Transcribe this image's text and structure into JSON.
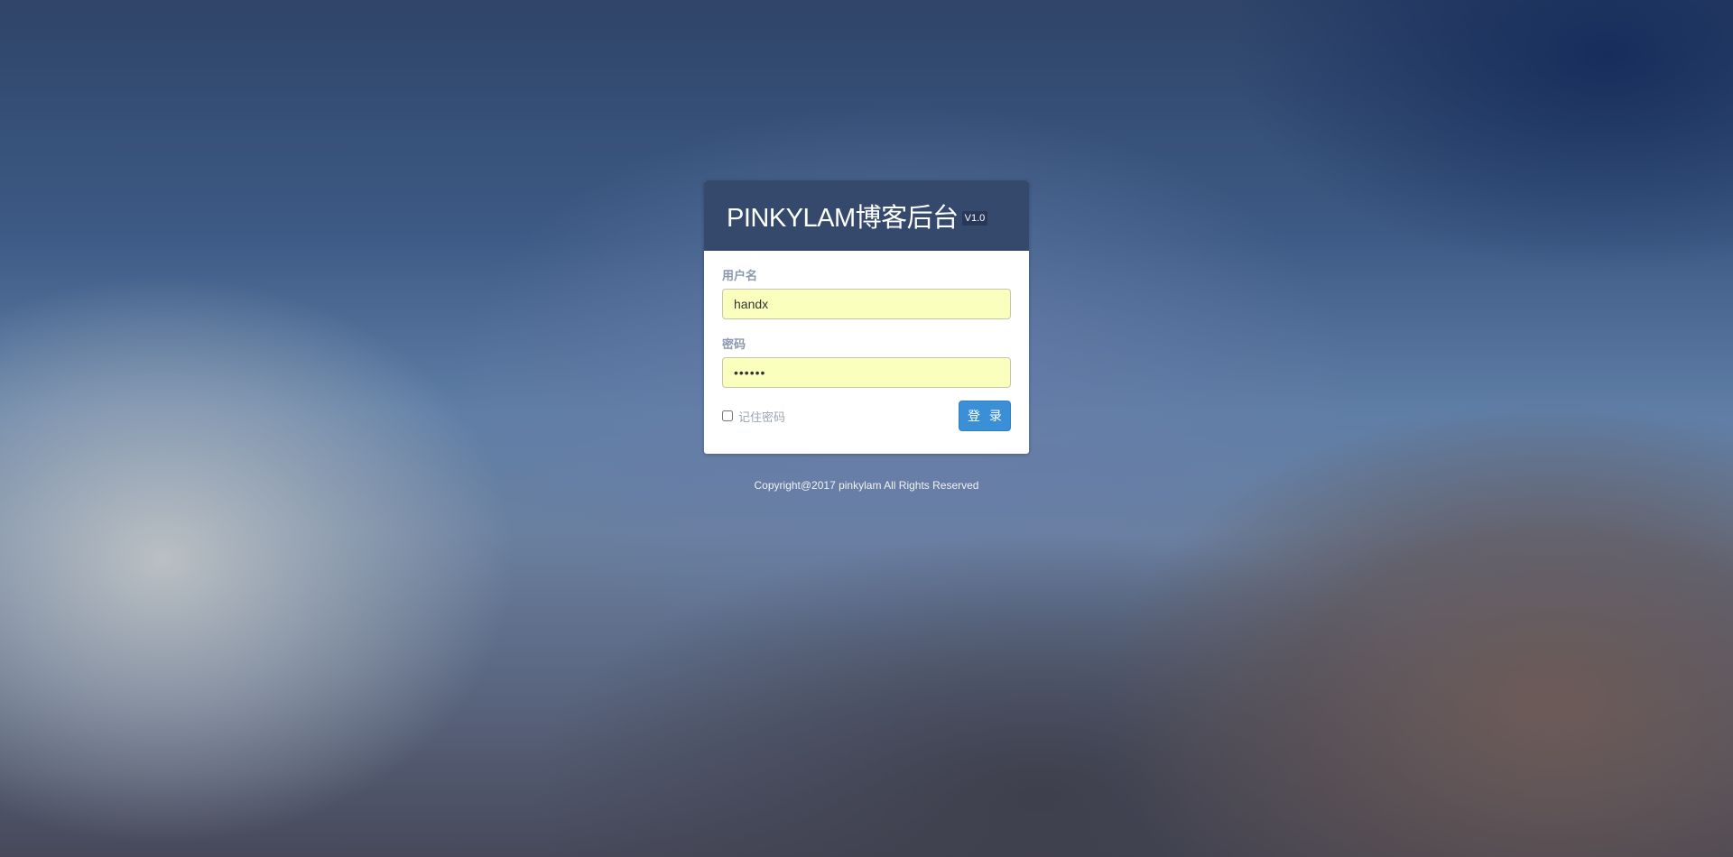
{
  "login": {
    "title": "PINKYLAM博客后台",
    "version": "V1.0",
    "username_label": "用户名",
    "username_value": "handx",
    "password_label": "密码",
    "password_value": "••••••",
    "remember_label": "记住密码",
    "submit_label": "登 录"
  },
  "footer": {
    "copyright": "Copyright@2017 pinkylam All Rights Reserved"
  },
  "colors": {
    "header_bg": "#34496b",
    "input_autofill_bg": "#faffbd",
    "button_primary": "#3a8fd6"
  }
}
